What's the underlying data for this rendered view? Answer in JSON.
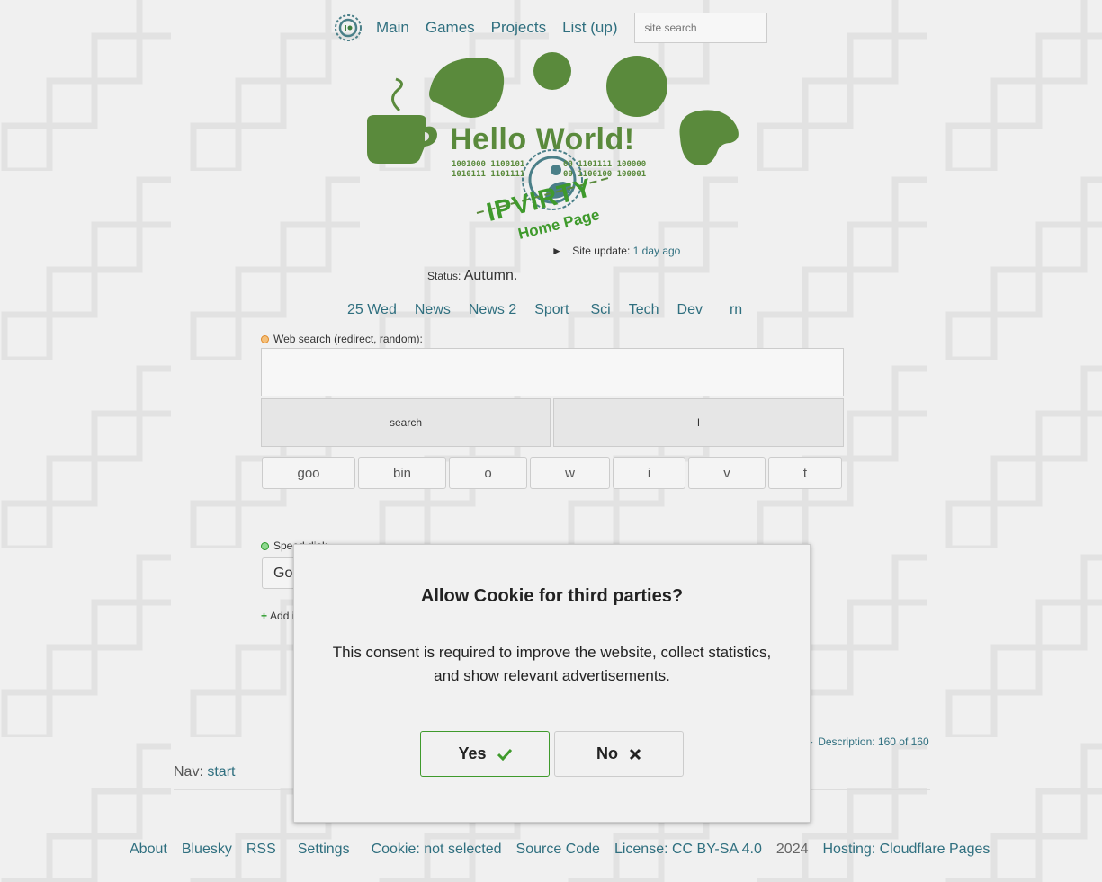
{
  "colors": {
    "accent_link": "#2f6f7f",
    "brand_green": "#5a8a3c",
    "yes_green": "#3f9a2c",
    "background": "#f0f0f0"
  },
  "topnav": {
    "logo_icon": "site-logo-icon",
    "links": [
      "Main",
      "Games",
      "Projects",
      "List (up)"
    ],
    "search_placeholder": "site search"
  },
  "hero": {
    "headline": "Hello World!",
    "binary_left": [
      "1001000 1100101",
      "1010111 1101111"
    ],
    "binary_right": [
      "00 1101111 100000",
      "00 1100100 100001"
    ],
    "brand": "IPVIRTY",
    "subtitle": "Home Page"
  },
  "site_update": {
    "label": "Site update:",
    "value": "1 day ago"
  },
  "status": {
    "label": "Status:",
    "value": "Autumn."
  },
  "topics": [
    "25 Wed",
    "News",
    "News 2",
    "Sport",
    "Sci",
    "Tech",
    "Dev",
    "rn"
  ],
  "web_search": {
    "label": "Web search (redirect, random):",
    "search_button": "search",
    "lucky_button": "l",
    "engines": [
      "goo",
      "bin",
      "o",
      "w",
      "i",
      "v",
      "t"
    ]
  },
  "speed_dial": {
    "label": "Speed dial:",
    "selected": "Goo",
    "add_item": "Add i"
  },
  "description": {
    "label": "Description:",
    "value": "160 of 160"
  },
  "nav": {
    "label": "Nav:",
    "link": "start"
  },
  "footer": {
    "links": [
      "About",
      "Bluesky",
      "RSS",
      "Settings",
      "Cookie: not selected",
      "Source Code",
      "License: CC BY-SA 4.0"
    ],
    "year": "2024",
    "hosting": "Hosting: Cloudflare Pages"
  },
  "cookie_modal": {
    "title": "Allow Cookie for third parties?",
    "text": "This consent is required to improve the website, collect statistics, and show relevant advertisements.",
    "yes": "Yes",
    "no": "No"
  }
}
